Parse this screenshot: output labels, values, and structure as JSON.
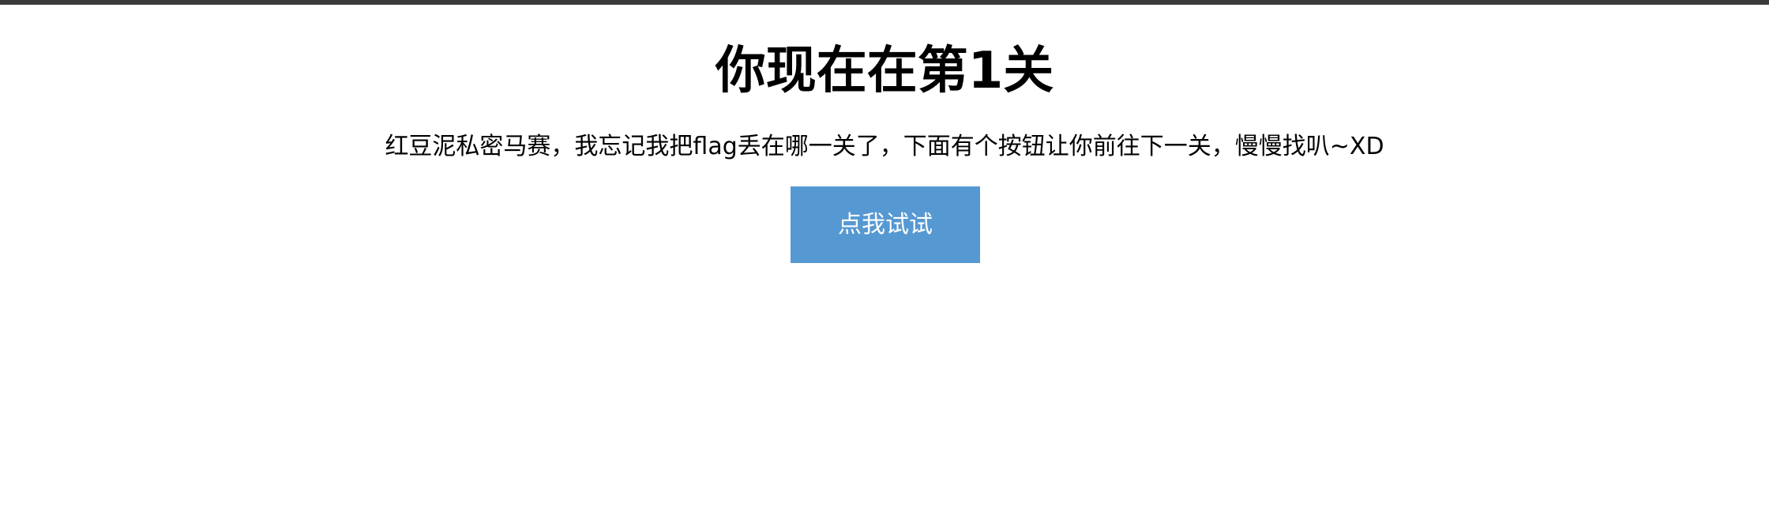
{
  "page": {
    "title": "你现在在第1关",
    "description": "红豆泥私密马赛，我忘记我把flag丢在哪一关了，下面有个按钮让你前往下一关，慢慢找叭~XD",
    "button_label": "点我试试"
  },
  "colors": {
    "top_bar": "#3a3a3a",
    "button_background": "#5699d2",
    "button_text": "#ffffff",
    "page_background": "#ffffff"
  }
}
